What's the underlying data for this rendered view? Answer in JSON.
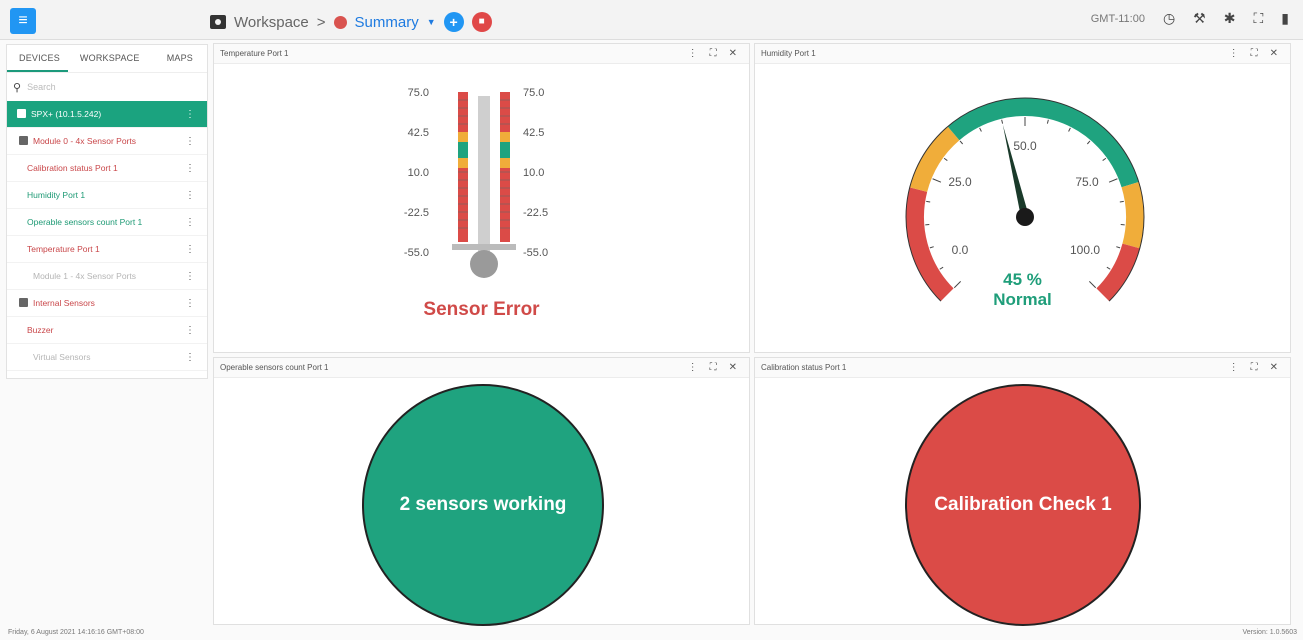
{
  "topbar": {
    "breadcrumb_root": "Workspace",
    "breadcrumb_sep": ">",
    "breadcrumb_current": "Summary",
    "timezone": "GMT-11:00",
    "icons": [
      "menu-icon",
      "camera-icon",
      "add-icon",
      "save-icon",
      "clock-icon",
      "wrench-icon",
      "bug-icon",
      "fullscreen-icon",
      "trash-icon"
    ]
  },
  "sidebar": {
    "tabs": [
      "DEVICES",
      "WORKSPACE",
      "MAPS"
    ],
    "search_placeholder": "Search",
    "items": [
      {
        "label": "SPX+ (10.1.5.242)"
      },
      {
        "label": "Module 0 - 4x Sensor Ports"
      },
      {
        "label": "Calibration status Port 1"
      },
      {
        "label": "Humidity Port 1"
      },
      {
        "label": "Operable sensors count Port 1"
      },
      {
        "label": "Temperature Port 1"
      },
      {
        "label": "Module 1 - 4x Sensor Ports"
      },
      {
        "label": "Internal Sensors"
      },
      {
        "label": "Buzzer"
      },
      {
        "label": "Virtual Sensors"
      }
    ]
  },
  "panels": {
    "temperature": {
      "title": "Temperature Port 1",
      "scale": [
        "75.0",
        "42.5",
        "10.0",
        "-22.5",
        "-55.0"
      ],
      "status": "Sensor Error"
    },
    "humidity": {
      "title": "Humidity Port 1",
      "scale": [
        "0.0",
        "25.0",
        "50.0",
        "75.0",
        "100.0"
      ],
      "value_label": "45 %",
      "value": 45,
      "status": "Normal"
    },
    "operable": {
      "title": "Operable sensors count Port 1",
      "status": "2 sensors working"
    },
    "calibration": {
      "title": "Calibration status Port 1",
      "status": "Calibration Check 1"
    }
  },
  "colors": {
    "green": "#1fa37f",
    "red": "#db4b47",
    "amber": "#f0ad3a",
    "blue": "#2196f3"
  },
  "statusbar": {
    "datetime": "Friday, 6 August 2021 14:16:16 GMT+08:00",
    "version": "Version: 1.0.5603"
  }
}
